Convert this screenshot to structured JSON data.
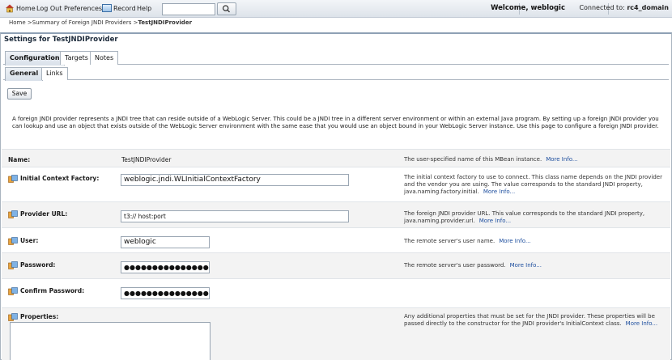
{
  "topbar": {
    "home": "Home",
    "logout": "Log Out",
    "preferences": "Preferences",
    "record": "Record",
    "help": "Help",
    "search_value": "",
    "welcome": "Welcome, weblogic",
    "connected_label": "Connected to:",
    "connected_domain": "rc4_domain"
  },
  "breadcrumb": {
    "trail": "Home >Summary of Foreign JNDI Providers >",
    "current": "TestJNDIProvider"
  },
  "panel": {
    "title": "Settings for TestJNDIProvider"
  },
  "tabs": [
    "Configuration",
    "Targets",
    "Notes"
  ],
  "subtabs": [
    "General",
    "Links"
  ],
  "save_label": "Save",
  "description": "A foreign JNDI provider represents a JNDI tree that can reside outside of a WebLogic Server. This could be a JNDI tree in a different server environment or within an external Java program. By setting up a foreign JNDI provider you can lookup and use an object that exists outside of the WebLogic Server environment with the same ease that you would use an object bound in your WebLogic Server instance. Use this page to configure a foreign JNDI provider.",
  "more_info": "More Info...",
  "fields": {
    "name": {
      "label": "Name:",
      "value": "TestJNDIProvider",
      "help": "The user-specified name of this MBean instance."
    },
    "initial_context_factory": {
      "label": "Initial Context Factory:",
      "value": "weblogic.jndi.WLInitialContextFactory",
      "help": "The initial context factory to use to connect. This class name depends on the JNDI provider and the vendor you are using. The value corresponds to the standard JNDI property, java.naming.factory.initial."
    },
    "provider_url": {
      "label": "Provider URL:",
      "value": "t3:// host:port",
      "help": "The foreign JNDI provider URL. This value corresponds to the standard JNDI property, java.naming.provider.url."
    },
    "user": {
      "label": "User:",
      "value": "weblogic",
      "help": "The remote server's user name."
    },
    "password": {
      "label": "Password:",
      "value": "●●●●●●●●●●●●●●●●●●●",
      "help": "The remote server's user password."
    },
    "confirm_password": {
      "label": "Confirm Password:",
      "value": "●●●●●●●●●●●●●●●●●●●"
    },
    "properties": {
      "label": "Properties:",
      "value": "",
      "help": "Any additional properties that must be set for the JNDI provider. These properties will be passed directly to the constructor for the JNDI provider's InitialContext class."
    }
  },
  "icons": {
    "home": "home-icon",
    "record": "record-icon",
    "search": "search-icon",
    "field": "dynamic-field-icon"
  },
  "colors": {
    "link": "#1d4e9e",
    "shaded_row": "#f3f3f3",
    "topbar": "#dde3ea"
  }
}
